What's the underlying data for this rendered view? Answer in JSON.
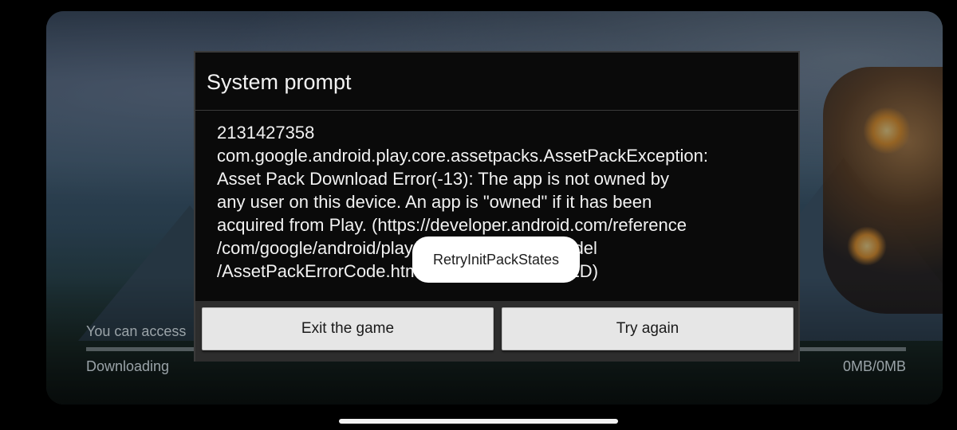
{
  "background": {
    "access_text": "You can access",
    "downloading_label": "Downloading",
    "download_size": "0MB/0MB"
  },
  "dialog": {
    "title": "System prompt",
    "message": "2131427358\ncom.google.android.play.core.assetpacks.AssetPackException:\nAsset Pack Download Error(-13): The app is not owned by\nany user on this device. An app is \"owned\" if it has been\nacquired from Play. (https://developer.android.com/reference\n/com/google/android/play/core/assetpacks/model\n/AssetPackErrorCode.html#APP_NOT_OWNED)",
    "exit_button": "Exit the game",
    "retry_button": "Try again"
  },
  "toast": {
    "text": "RetryInitPackStates"
  },
  "colors": {
    "dialog_bg": "#0a0a0a",
    "button_bg": "#e6e6e6",
    "toast_bg": "#ffffff"
  }
}
